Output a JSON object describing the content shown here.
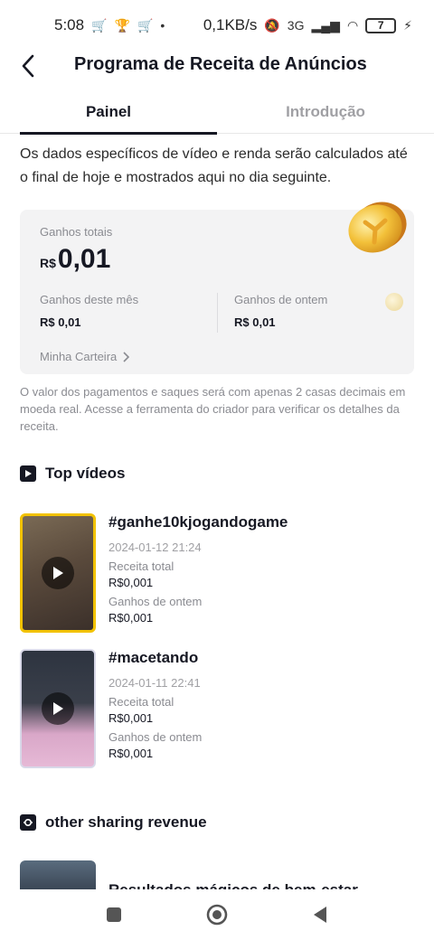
{
  "status_bar": {
    "time": "5:08",
    "speed": "0,1KB/s",
    "network": "3G",
    "battery": "7"
  },
  "header": {
    "title": "Programa de Receita de Anúncios"
  },
  "tabs": [
    {
      "label": "Painel",
      "active": true
    },
    {
      "label": "Introdução",
      "active": false
    }
  ],
  "intro_text": "Os dados específicos de vídeo e renda serão calculados até o final de hoje e mostrados aqui no dia seguinte.",
  "earnings": {
    "total_label": "Ganhos totais",
    "currency": "R$",
    "total_amount": "0,01",
    "month_label": "Ganhos deste mês",
    "month_value": "R$ 0,01",
    "yesterday_label": "Ganhos de ontem",
    "yesterday_value": "R$ 0,01",
    "wallet_link": "Minha Carteira"
  },
  "disclaimer": "O valor dos pagamentos e saques será com apenas 2 casas decimais em moeda real. Acesse a ferramenta do criador para verificar os detalhes da receita.",
  "top_videos": {
    "title": "Top vídeos",
    "items": [
      {
        "title": "#ganhe10kjogandogame",
        "date": "2024-01-12 21:24",
        "revenue_label": "Receita total",
        "revenue": "R$0,001",
        "yesterday_label": "Ganhos de ontem",
        "yesterday": "R$0,001"
      },
      {
        "title": "#macetando",
        "date": "2024-01-11 22:41",
        "revenue_label": "Receita total",
        "revenue": "R$0,001",
        "yesterday_label": "Ganhos de ontem",
        "yesterday": "R$0,001"
      }
    ]
  },
  "other_sharing": {
    "title": "other sharing revenue",
    "partial_item_text": "Resultados mágicos de bem-estar de"
  },
  "colors": {
    "accent_highlight": "#f2c200",
    "text_primary": "#161823",
    "text_secondary": "#8a8b91",
    "card_bg": "#f3f3f4"
  },
  "icons": [
    "back-arrow-icon",
    "coin-icon",
    "chevron-right-icon",
    "video-play-icon",
    "share-revenue-icon",
    "nav-square-icon",
    "nav-circle-icon",
    "nav-back-icon"
  ]
}
